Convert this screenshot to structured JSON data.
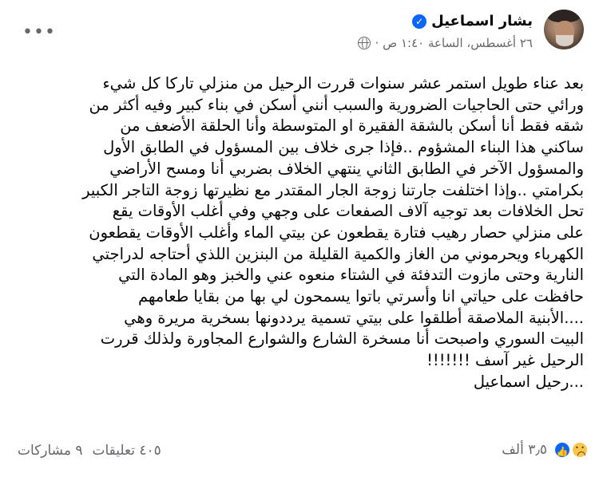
{
  "post": {
    "author": "بشار اسماعيل",
    "timestamp": "٢٦ أغسطس، الساعة ١:٤٠ ص ·",
    "privacy_icon": "globe-icon",
    "more_icon": "more-options-icon",
    "more_glyph": "•••",
    "verified_glyph": "✓",
    "body_lines": [
      "بعد عناء طويل استمر عشر سنوات قررت الرحيل من منزلي تاركا كل شيء",
      "ورائي حتى الحاجيات الضرورية والسبب أنني أسكن في بناء كبير وفيه أكثر من",
      "شقه فقط أنا أسكن بالشقة الفقيرة او المتوسطة وأنا الحلقة الأضعف من",
      "ساكني هذا البناء المشؤوم ..فإذا جرى خلاف بين المسؤول في الطابق الأول",
      "والمسؤول الآخر في الطابق الثاني ينتهي الخلاف بضربي أنا ومسح الأراضي",
      "بكرامتي ..وإذا اختلفت جارتنا زوجة الجار المقتدر مع نظيرتها زوجة التاجر الكبير",
      "تحل الخلافات بعد توجيه آلاف الصفعات على وجهي   وفي أغلب الأوقات يقع",
      "على منزلي حصار رهيب فتارة يقطعون عن بيتي الماء وأغلب الأوقات يقطعون",
      "الكهرباء ويحرموني من الغاز والكمية القليلة من البنزين اللذي أحتاجه لدراجتي",
      "النارية وحتى مازوت التدفئة في الشتاء منعوه عني والخبز وهو المادة التي",
      "حافظت على حياتي انا وأسرتي باتوا يسمحون لي بها من بقايا طعامهم",
      "....الأبنية الملاصقة أطلقوا على بيتي تسمية يرددونها بسخرية مريرة وهي",
      "البيت السوري واصبحت أنا مسخرة الشارع والشوارع المجاورة ولذلك قررت",
      "الرحيل غير آسف !!!!!!!",
      "...رحيل اسماعيل"
    ]
  },
  "footer": {
    "reaction_icons": [
      "like-icon",
      "sad-icon"
    ],
    "like_glyph": "👍",
    "reaction_count": "٣٫٥ ألف",
    "comments": "٤٠٥ تعليقات",
    "shares": "٩ مشاركات"
  },
  "colors": {
    "text": "#050505",
    "secondary": "#65676b",
    "accent": "#0866ff",
    "sad_reaction": "#f7c64a"
  }
}
